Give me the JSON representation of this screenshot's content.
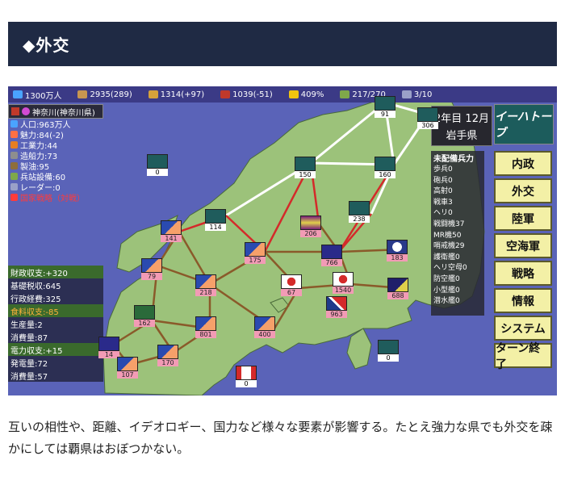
{
  "header": {
    "title": "◆外交"
  },
  "topbar": [
    {
      "icon": "population-icon",
      "value": "1300万人",
      "color": "#4aa3ff"
    },
    {
      "icon": "money-bag-icon",
      "value": "2935(289)",
      "color": "#c89650"
    },
    {
      "icon": "food-icon",
      "value": "1314(+97)",
      "color": "#d6a13a"
    },
    {
      "icon": "fuel-icon",
      "value": "1039(-51)",
      "color": "#c0392b"
    },
    {
      "icon": "approval-icon",
      "value": "409%",
      "color": "#f1c40f"
    },
    {
      "icon": "supply-icon",
      "value": "217/270",
      "color": "#7fa84a"
    },
    {
      "icon": "turn-icon",
      "value": "3/10",
      "color": "#9aa0c8"
    }
  ],
  "prefecture": {
    "name": "神奈川(神奈川県)",
    "stats": [
      {
        "icon": "people-icon",
        "label": "人口:963万人",
        "color": "#4aa3ff"
      },
      {
        "icon": "heart-icon",
        "label": "魅力:84(-2)",
        "color": "#ff7043"
      },
      {
        "icon": "factory-icon",
        "label": "工業力:44",
        "color": "#e67e22"
      },
      {
        "icon": "ship-icon",
        "label": "造船力:73",
        "color": "#8e8e8e"
      },
      {
        "icon": "oil-icon",
        "label": "製油:95",
        "color": "#8e6e3a"
      },
      {
        "icon": "supply-icon",
        "label": "兵站設備:60",
        "color": "#7fa84a"
      },
      {
        "icon": "radar-icon",
        "label": "レーダー:0",
        "color": "#9aa0c8"
      },
      {
        "icon": "flag-icon",
        "label": "国家戦略（対戦）",
        "color": "#ff3b3b",
        "red": true
      }
    ]
  },
  "economy": [
    {
      "label": "財政収支:+320",
      "style": "green"
    },
    {
      "label": "基礎税収:645",
      "style": "dark"
    },
    {
      "label": "行政経費:325",
      "style": "dark"
    },
    {
      "label": "食料収支:-85",
      "style": "orange"
    },
    {
      "label": "生産量:2",
      "style": "dark"
    },
    {
      "label": "消費量:87",
      "style": "dark"
    },
    {
      "label": "電力収支:+15",
      "style": "green"
    },
    {
      "label": "発電量:72",
      "style": "dark"
    },
    {
      "label": "消費量:57",
      "style": "dark"
    }
  ],
  "date": {
    "line1": "2年目 12月",
    "line2": "岩手県"
  },
  "leader": "イーハトーブ",
  "troops": {
    "title": "未配備兵力",
    "items": [
      "歩兵0",
      "砲兵0",
      "高射0",
      "戦車3",
      "ヘリ0",
      "戦闘機37",
      "MR機50",
      "哨戒機29",
      "護衛艦0",
      "ヘリ空母0",
      "防空艦0",
      "小型艦0",
      "潜水艦0"
    ]
  },
  "menu": [
    "内政",
    "外交",
    "陸軍",
    "空海軍",
    "戦略",
    "情報",
    "システム",
    "ターン終了"
  ],
  "nodes": [
    {
      "value": "91",
      "badge": "white",
      "flag": "ihatov"
    },
    {
      "value": "306",
      "badge": "white",
      "flag": "ihatov"
    },
    {
      "value": "0",
      "badge": "white",
      "flag": "ihatov"
    },
    {
      "value": "150",
      "badge": "white",
      "flag": "ihatov"
    },
    {
      "value": "160",
      "badge": "white",
      "flag": "ihatov"
    },
    {
      "value": "114",
      "badge": "white",
      "flag": "ihatov"
    },
    {
      "value": "238",
      "badge": "white",
      "flag": "ihatov"
    },
    {
      "value": "206",
      "badge": "pink",
      "flag": "purple"
    },
    {
      "value": "141",
      "badge": "pink",
      "flag": "fuji"
    },
    {
      "value": "175",
      "badge": "pink",
      "flag": "fuji"
    },
    {
      "value": "766",
      "badge": "pink",
      "flag": "navy"
    },
    {
      "value": "183",
      "badge": "pink",
      "flag": "emblem"
    },
    {
      "value": "79",
      "badge": "pink",
      "flag": "fuji"
    },
    {
      "value": "218",
      "badge": "pink",
      "flag": "fuji"
    },
    {
      "value": "67",
      "badge": "pink",
      "flag": "rising"
    },
    {
      "value": "1540",
      "badge": "pink",
      "flag": "rising"
    },
    {
      "value": "688",
      "badge": "pink",
      "flag": "navyflag"
    },
    {
      "value": "963",
      "badge": "pink",
      "flag": "union"
    },
    {
      "value": "162",
      "badge": "pink",
      "flag": "green"
    },
    {
      "value": "801",
      "badge": "pink",
      "flag": "fuji"
    },
    {
      "value": "400",
      "badge": "pink",
      "flag": "fuji"
    },
    {
      "value": "14",
      "badge": "pink",
      "flag": "navy"
    },
    {
      "value": "170",
      "badge": "pink",
      "flag": "fuji"
    },
    {
      "value": "107",
      "badge": "pink",
      "flag": "fuji"
    },
    {
      "value": "0",
      "badge": "white",
      "flag": "ihatov"
    },
    {
      "value": "0",
      "badge": "white",
      "flag": "maple"
    }
  ],
  "caption": "互いの相性や、距離、イデオロギー、国力など様々な要素が影響する。たとえ強力な県でも外交を疎かにしては覇県はおぼつかない。"
}
